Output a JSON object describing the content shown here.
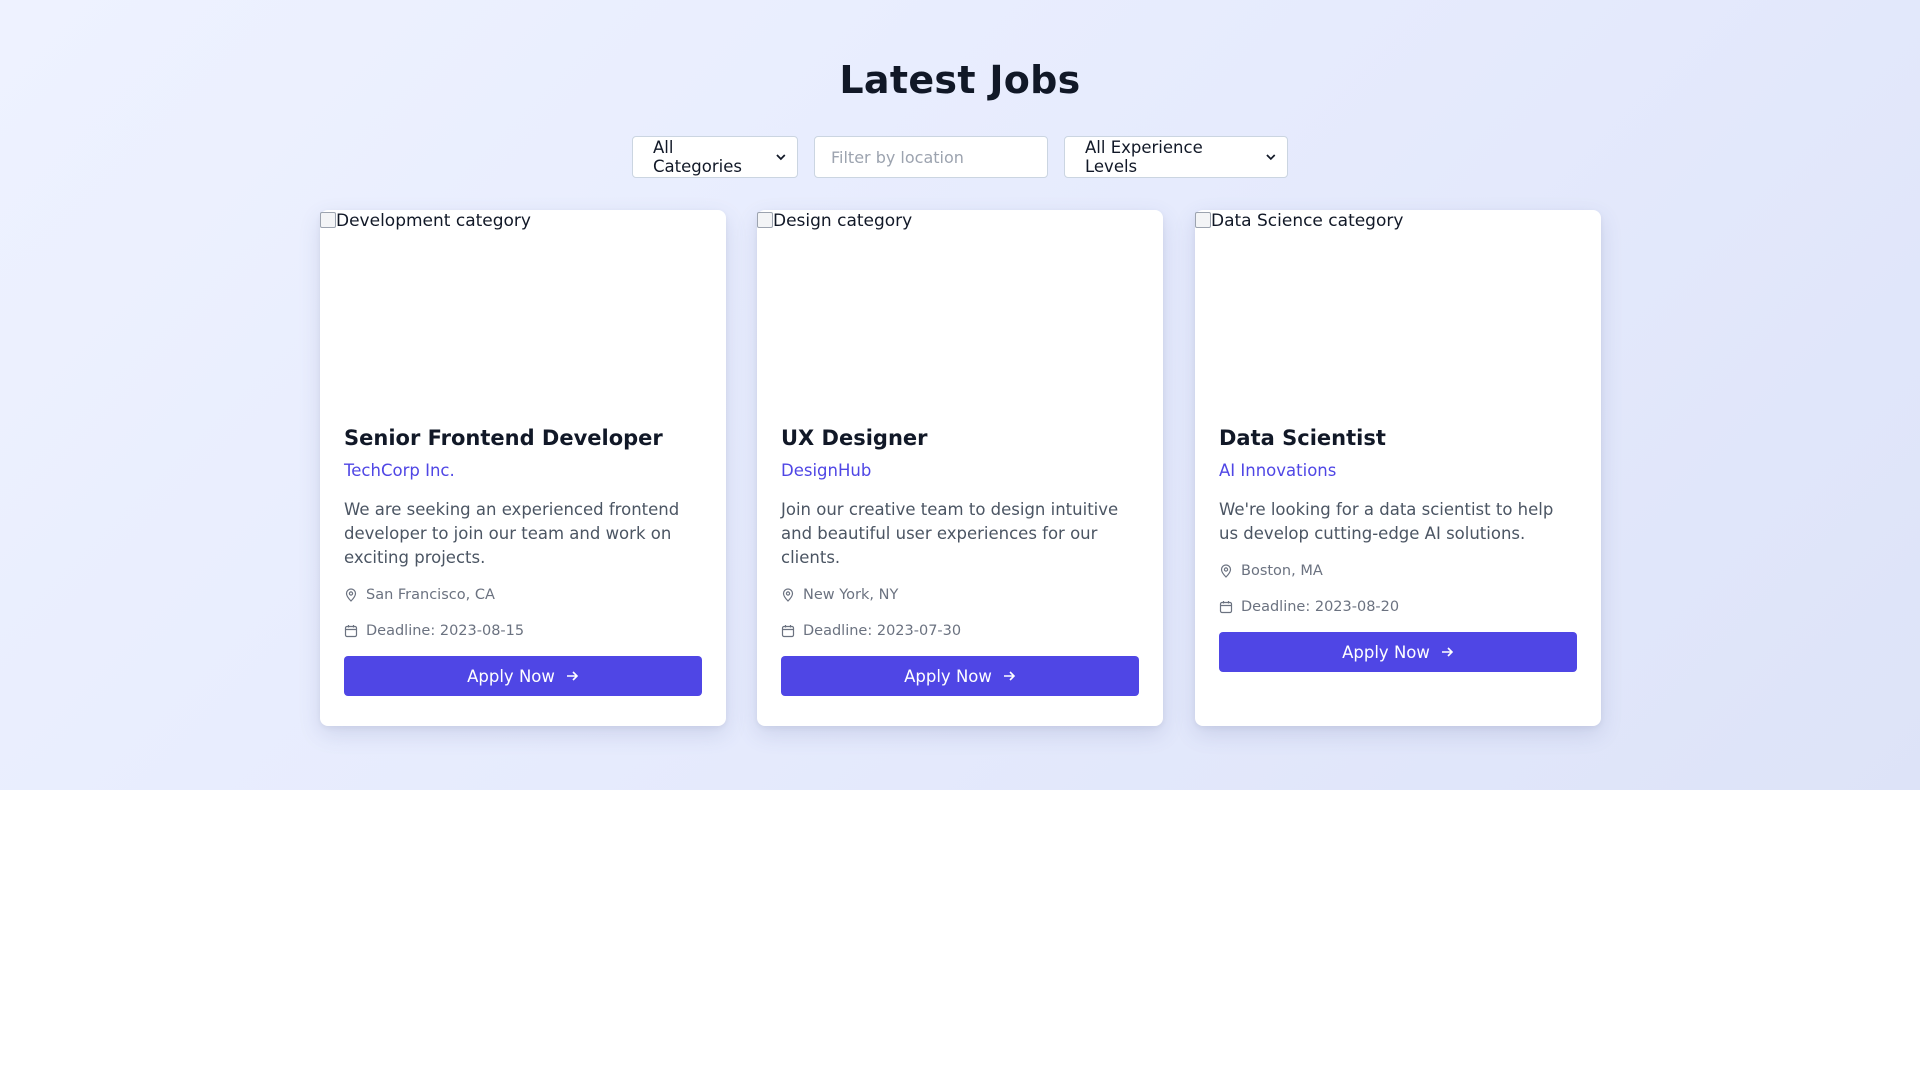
{
  "page": {
    "title": "Latest Jobs"
  },
  "filters": {
    "category_selected": "All Categories",
    "location_placeholder": "Filter by location",
    "experience_selected": "All Experience Levels"
  },
  "colors": {
    "accent": "#4f46e5",
    "heading": "#111827",
    "muted": "#6b7280"
  },
  "jobs": [
    {
      "image_alt": "Development category",
      "title": "Senior Frontend Developer",
      "company": "TechCorp Inc.",
      "description": "We are seeking an experienced frontend developer to join our team and work on exciting projects.",
      "location": "San Francisco, CA",
      "deadline": "Deadline: 2023-08-15",
      "apply_label": "Apply Now"
    },
    {
      "image_alt": "Design category",
      "title": "UX Designer",
      "company": "DesignHub",
      "description": "Join our creative team to design intuitive and beautiful user experiences for our clients.",
      "location": "New York, NY",
      "deadline": "Deadline: 2023-07-30",
      "apply_label": "Apply Now"
    },
    {
      "image_alt": "Data Science category",
      "title": "Data Scientist",
      "company": "AI Innovations",
      "description": "We're looking for a data scientist to help us develop cutting-edge AI solutions.",
      "location": "Boston, MA",
      "deadline": "Deadline: 2023-08-20",
      "apply_label": "Apply Now"
    }
  ]
}
